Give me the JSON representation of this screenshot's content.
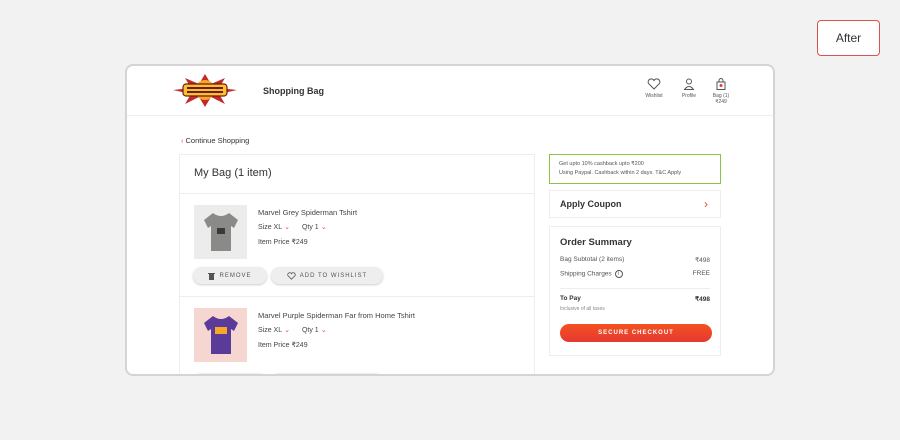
{
  "badge": {
    "label": "After"
  },
  "header": {
    "title": "Shopping Bag",
    "wishlist": "Wishlist",
    "profile": "Profile",
    "bag_label": "Bag (1)",
    "bag_amount": "₹249"
  },
  "continue": {
    "label": "Continue Shopping"
  },
  "bag": {
    "title": "My Bag (1 item)"
  },
  "items": [
    {
      "name": "Marvel Grey Spiderman Tshirt",
      "size": "Size XL",
      "qty": "Qty 1",
      "price": "Item Price ₹249",
      "remove": "REMOVE",
      "wishlist": "ADD TO WISHLIST",
      "color": "#8a8a88"
    },
    {
      "name": "Marvel Purple Spiderman Far from Home Tshirt",
      "size": "Size XL",
      "qty": "Qty 1",
      "price": "Item Price ₹249",
      "color": "#5b3b9a"
    }
  ],
  "cashback": {
    "line1": "Get upto 10% cashback upto ₹200",
    "line2": "Using Paypal. Cashback within 2 days. T&C Apply"
  },
  "coupon": {
    "label": "Apply Coupon",
    "arrow": "›"
  },
  "summary": {
    "title": "Order Summary",
    "subtotal_label": "Bag Subtotal (2 items)",
    "subtotal_value": "₹498",
    "shipping_label": "Shipping Charges",
    "shipping_value": "FREE",
    "pay_label": "To Pay",
    "pay_value": "₹498",
    "pay_note": "Inclusive of all taxes",
    "checkout": "SECURE CHECKOUT"
  },
  "colors": {
    "accent": "#e53935",
    "cashback_border": "#8bc34a"
  }
}
